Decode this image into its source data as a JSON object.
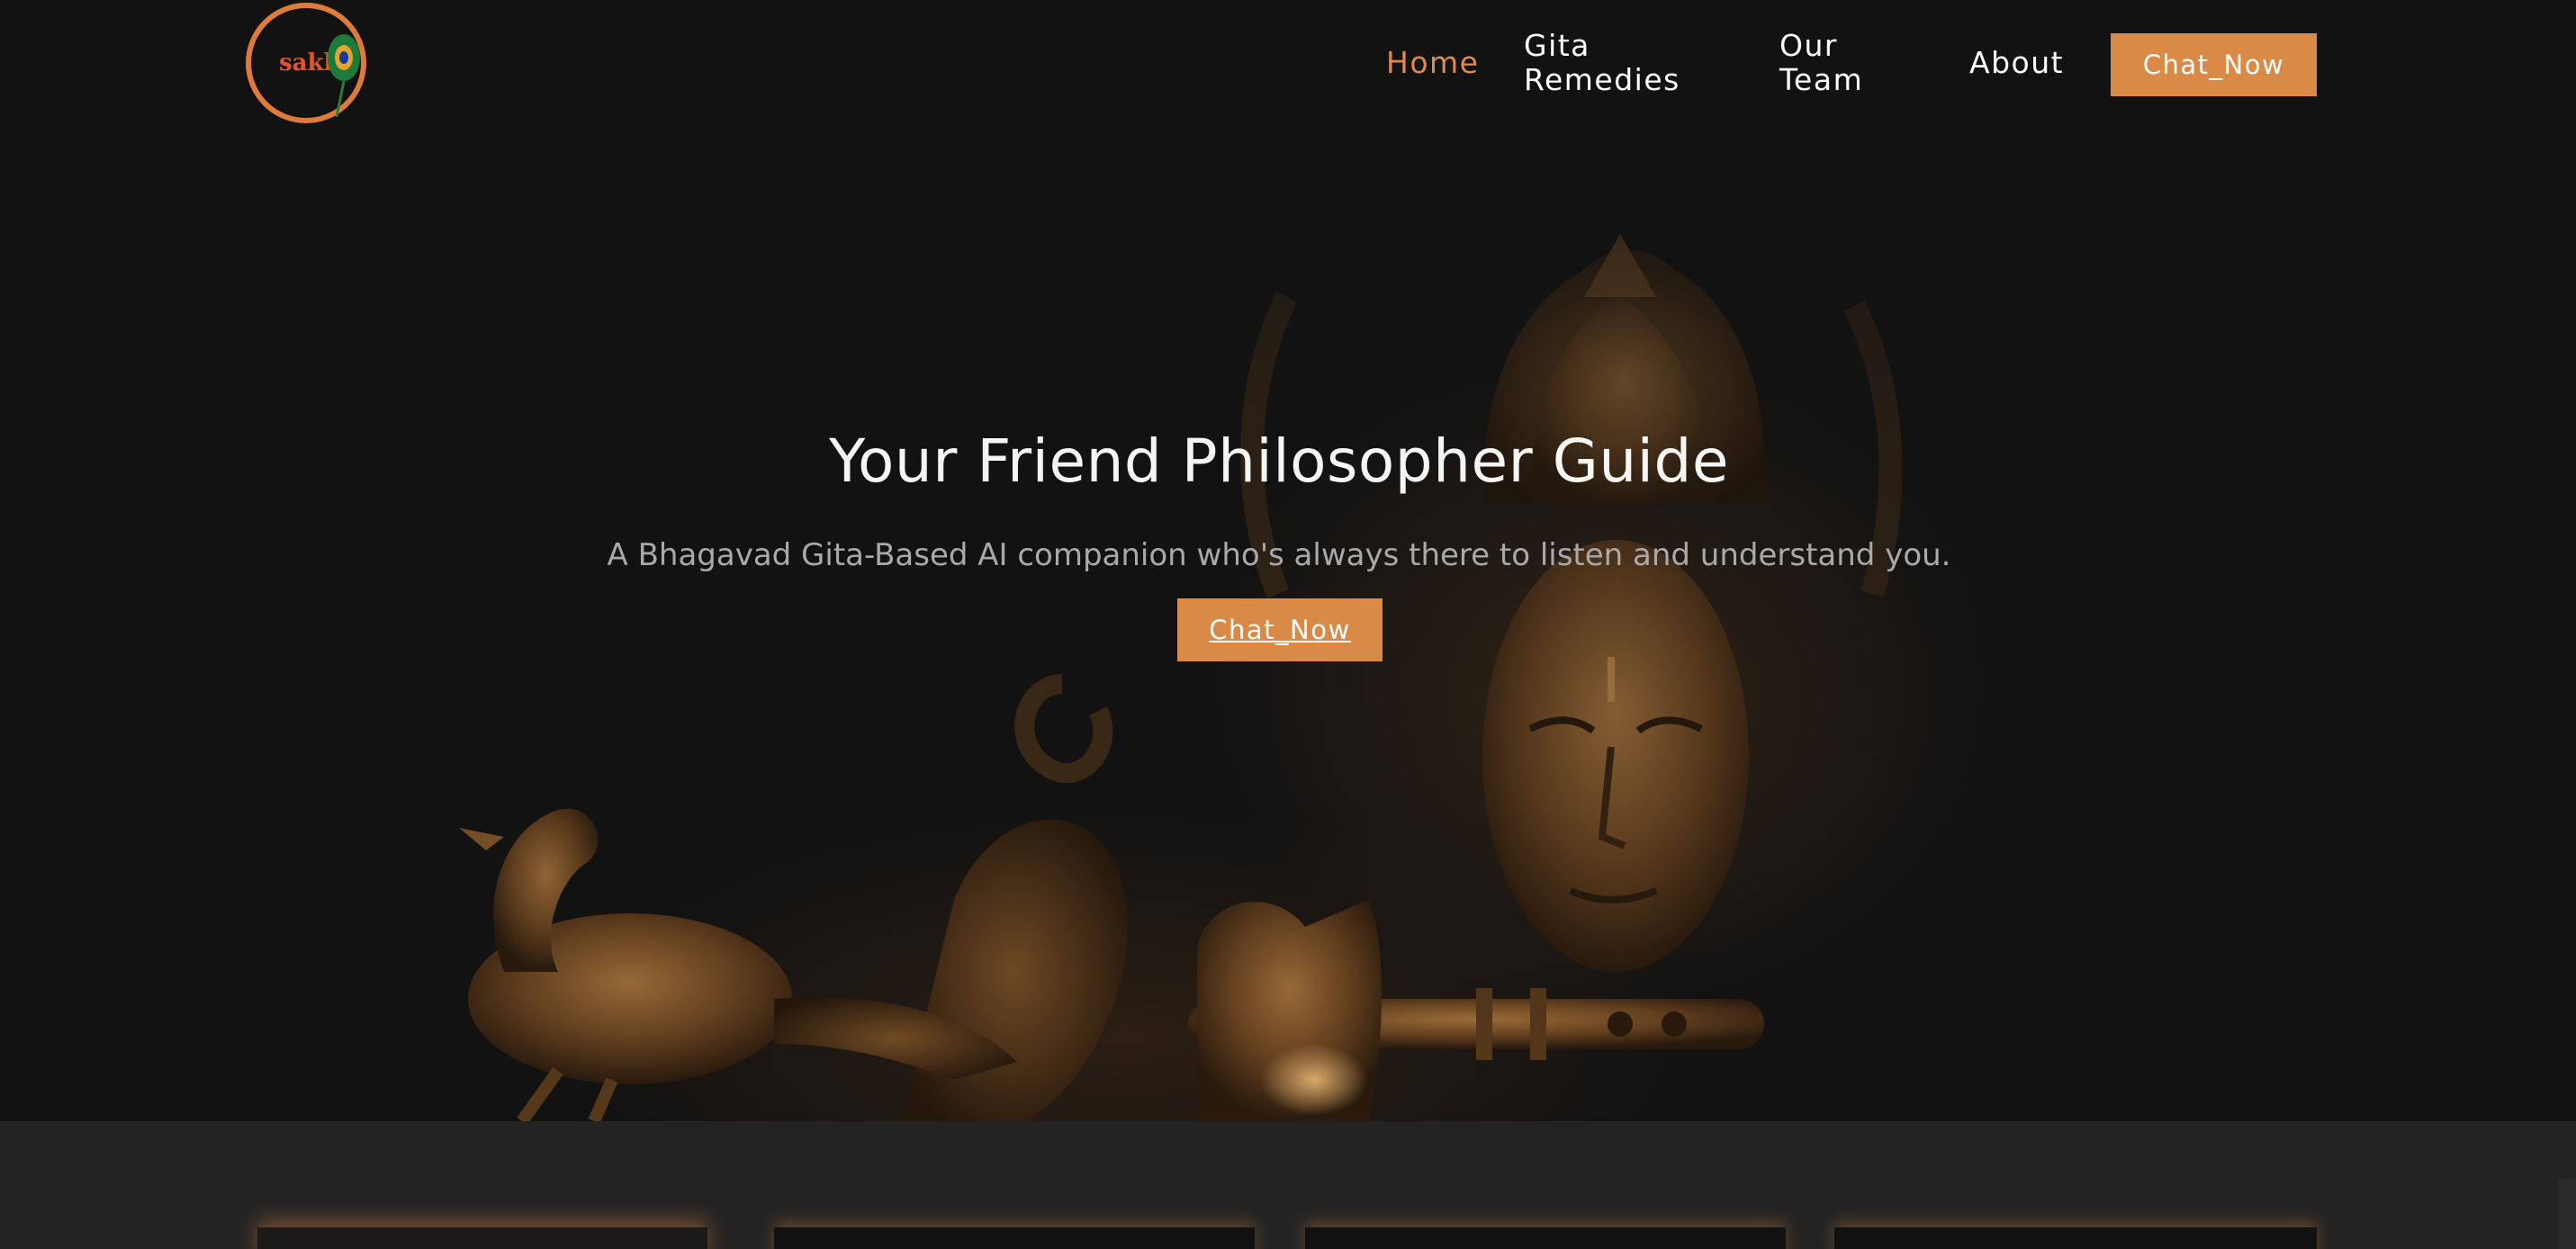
{
  "nav": {
    "logo_text": "sakha",
    "links": [
      {
        "label": "Home",
        "active": true
      },
      {
        "label": "Gita Remedies",
        "active": false
      },
      {
        "label": "Our Team",
        "active": false
      },
      {
        "label": "About",
        "active": false
      }
    ],
    "cta_label": "Chat_Now"
  },
  "hero": {
    "title": "Your Friend Philosopher Guide",
    "subtitle": "A Bhagavad Gita-Based AI companion who's always there to listen and understand you.",
    "cta_label": "Chat_Now",
    "background_icon": "krishna-statue-with-flute-and-peacock"
  },
  "colors": {
    "accent": "#d98a47",
    "active_link": "#e0894a",
    "background": "#121212",
    "section_background": "#232323"
  }
}
